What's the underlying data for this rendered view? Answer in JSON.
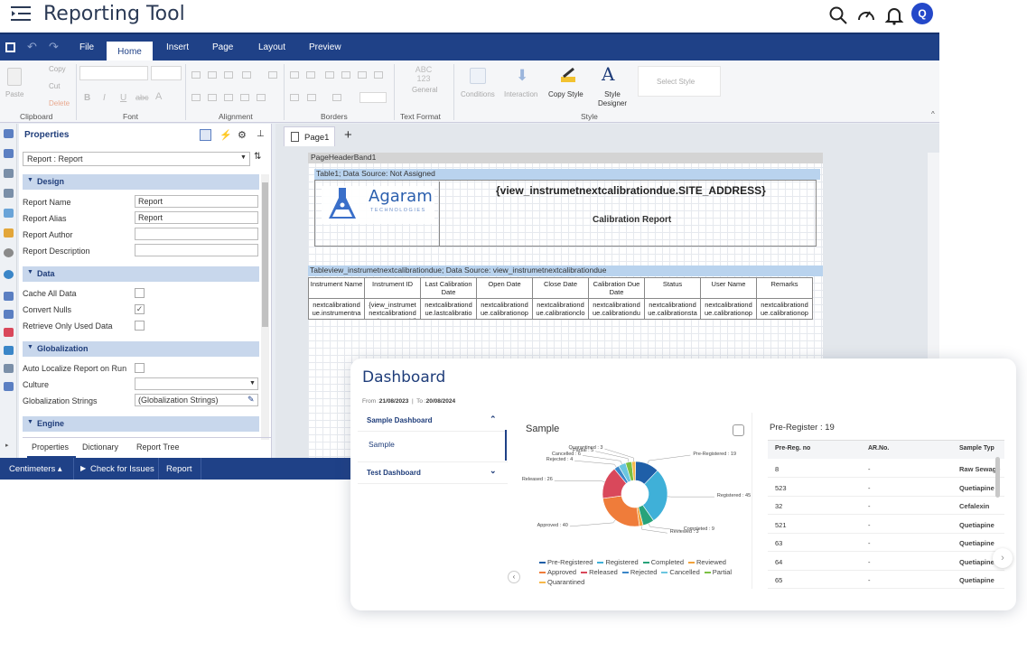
{
  "app": {
    "title": "Reporting Tool",
    "avatar_letter": "Q"
  },
  "menu": {
    "tabs": [
      "File",
      "Home",
      "Insert",
      "Page",
      "Layout",
      "Preview"
    ],
    "active": "Home"
  },
  "ribbon": {
    "clipboard": {
      "paste": "Paste",
      "copy": "Copy",
      "cut": "Cut",
      "delete": "Delete",
      "label": "Clipboard"
    },
    "font_label": "Font",
    "alignment_label": "Alignment",
    "borders_label": "Borders",
    "text_format": {
      "sample": "ABC 123",
      "general": "General",
      "label": "Text Format"
    },
    "conditions": "Conditions",
    "interaction": "Interaction",
    "copy_style": "Copy Style",
    "style_designer": "Style Designer",
    "select_style": "Select Style",
    "style_label": "Style"
  },
  "properties": {
    "title": "Properties",
    "object": "Report : Report",
    "sections": {
      "design": "Design",
      "data": "Data",
      "globalization": "Globalization",
      "engine": "Engine"
    },
    "design_rows": [
      {
        "label": "Report Name",
        "value": "Report"
      },
      {
        "label": "Report Alias",
        "value": "Report"
      },
      {
        "label": "Report Author",
        "value": ""
      },
      {
        "label": "Report Description",
        "value": ""
      }
    ],
    "data_rows": [
      {
        "label": "Cache All Data",
        "checked": false
      },
      {
        "label": "Convert Nulls",
        "checked": true
      },
      {
        "label": "Retrieve Only Used Data",
        "checked": false
      }
    ],
    "glob_rows": {
      "auto_localize": "Auto Localize Report on Run",
      "culture": "Culture",
      "strings_label": "Globalization Strings",
      "strings_value": "(Globalization Strings)"
    },
    "bottom_tabs": [
      "Properties",
      "Dictionary",
      "Report Tree"
    ]
  },
  "designer": {
    "page_tab": "Page1",
    "add_page": "+",
    "band_header": "PageHeaderBand1",
    "table1_caption": "Table1; Data Source: Not Assigned",
    "logo_name": "Agaram",
    "logo_sub": "TECHNOLOGIES",
    "site_address": "{view_instrumetnextcalibrationdue.SITE_ADDRESS}",
    "report_title": "Calibration Report",
    "tableview_caption": "Tableview_instrumetnextcalibrationdue; Data Source: view_instrumetnextcalibrationdue",
    "columns": [
      "Instrument Name",
      "Instrument ID",
      "Last Calibration Date",
      "Open Date",
      "Close Date",
      "Calibration Due Date",
      "Status",
      "User Name",
      "Remarks"
    ],
    "row": [
      "nextcalibrationd ue.instrumentna",
      "{view_instrumet nextcalibrationd ue.instrumentid}",
      "nextcalibrationd ue.lastcalibratio",
      "nextcalibrationd ue.calibrationop",
      "nextcalibrationd ue.calibrationclo",
      "nextcalibrationd ue.calibrationdu",
      "nextcalibrationd ue.calibrationsta",
      "nextcalibrationd ue.calibrationop",
      "nextcalibrationd ue.calibrationop"
    ]
  },
  "statusbar": {
    "units": "Centimeters ▴",
    "check": "Check for Issues",
    "report": "Report"
  },
  "dashboard": {
    "title": "Dashboard",
    "from_label": "From :",
    "from_date": "21/08/2023",
    "to_label": "To :",
    "to_date": "20/08/2024",
    "side": {
      "sample_dashboard": "Sample Dashboard",
      "sample": "Sample",
      "test_dashboard": "Test Dashboard"
    },
    "collapse": "‹",
    "next": "›",
    "prereg": {
      "title": "Pre-Register : 19",
      "headers": [
        "Pre-Reg. no",
        "AR.No.",
        "Sample Typ"
      ],
      "rows": [
        [
          "8",
          "-",
          "Raw Sewage"
        ],
        [
          "523",
          "-",
          "Quetiapine"
        ],
        [
          "32",
          "-",
          "Cefalexin"
        ],
        [
          "521",
          "-",
          "Quetiapine"
        ],
        [
          "63",
          "-",
          "Quetiapine"
        ],
        [
          "64",
          "-",
          "Quetiapine"
        ],
        [
          "65",
          "-",
          "Quetiapine"
        ]
      ]
    }
  },
  "chart_data": {
    "type": "pie",
    "title": "Sample",
    "donut": true,
    "categories": [
      "Pre-Registered",
      "Registered",
      "Completed",
      "Reviewed",
      "Approved",
      "Released",
      "Rejected",
      "Cancelled",
      "Partial",
      "Quarantined"
    ],
    "values": [
      19,
      45,
      9,
      3,
      40,
      26,
      4,
      6,
      5,
      3
    ],
    "colors": [
      "#1f5fa8",
      "#3fb0d8",
      "#27a37a",
      "#f2a23a",
      "#ef7c3a",
      "#d9485b",
      "#3a86c8",
      "#6bc6e0",
      "#7bc043",
      "#f7b84b"
    ],
    "labels": [
      "Pre-Registered : 19",
      "Registered : 45",
      "Completed : 9",
      "Reviewed : 3",
      "Approved : 40",
      "Released : 26",
      "Rejected : 4",
      "Cancelled : 6",
      "Partial : 5",
      "Quarantined : 3"
    ],
    "legend_position": "bottom"
  }
}
